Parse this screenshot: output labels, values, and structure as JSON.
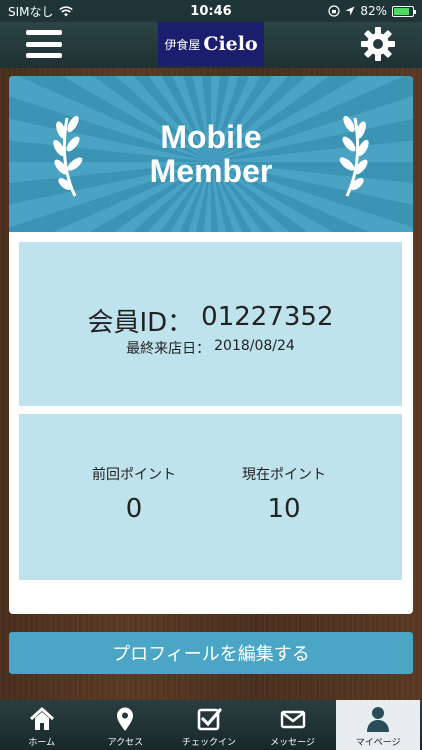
{
  "status_bar": {
    "carrier": "SIMなし",
    "time": "10:46",
    "battery": "82%",
    "battery_level": 0.82
  },
  "header": {
    "logo_jp": "伊食屋",
    "logo_en": "Cielo"
  },
  "banner": {
    "title_line1": "Mobile",
    "title_line2": "Member"
  },
  "member": {
    "id_label": "会員ID：",
    "id_value": "01227352",
    "last_visit_label": "最終来店日：",
    "last_visit_value": "2018/08/24"
  },
  "points": {
    "prev_label": "前回ポイント",
    "prev_value": "0",
    "current_label": "現在ポイント",
    "current_value": "10"
  },
  "profile_button": "プロフィールを編集する",
  "tabs": [
    {
      "label": "ホーム",
      "icon": "home-icon"
    },
    {
      "label": "アクセス",
      "icon": "map-pin-icon"
    },
    {
      "label": "チェックイン",
      "icon": "checkin-icon"
    },
    {
      "label": "メッセージ",
      "icon": "mail-icon"
    },
    {
      "label": "マイページ",
      "icon": "user-icon"
    }
  ],
  "colors": {
    "banner": "#4aa3c2",
    "panel": "#bfe3ec",
    "button": "#4ba6c5",
    "logo_bg": "#1b1d6e"
  }
}
